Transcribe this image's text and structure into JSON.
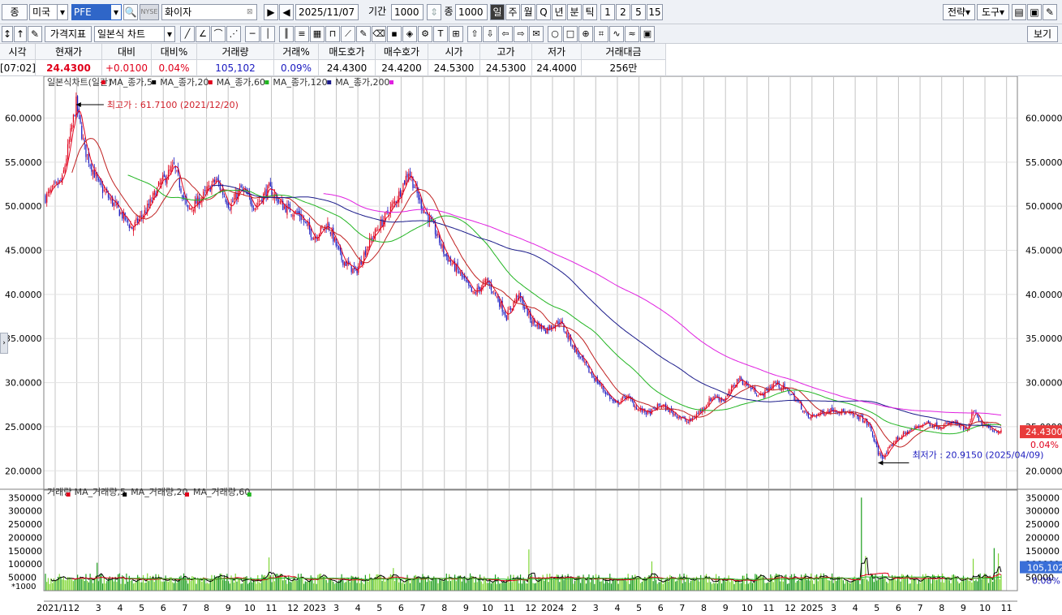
{
  "toolbar1": {
    "item_type": "종",
    "market": "미국",
    "ticker": "PFE",
    "exchange": "NYSE",
    "stock_name": "화이자",
    "date": "2025/11/07",
    "period_label": "기간",
    "period_value": "1000",
    "count_label": "종",
    "count_value": "1000",
    "periods": [
      "일",
      "주",
      "월",
      "Q",
      "년",
      "분",
      "틱"
    ],
    "minutes": [
      "1",
      "2",
      "5",
      "15"
    ],
    "strategy_label": "전략",
    "tools_label": "도구"
  },
  "toolbar2": {
    "indicator_label": "가격지표",
    "chart_type": "일본식 차트",
    "view_label": "보기"
  },
  "quote": {
    "headers": [
      "시각",
      "현재가",
      "대비",
      "대비%",
      "거래량",
      "거래%",
      "매도호가",
      "매수호가",
      "시가",
      "고가",
      "저가",
      "거래대금"
    ],
    "values": [
      "[07:02]",
      "24.4300",
      "+0.0100",
      "0.04%",
      "105,102",
      "0.09%",
      "24.4300",
      "24.4200",
      "24.5300",
      "24.5300",
      "24.4000",
      "256만"
    ]
  },
  "colors": {
    "up": "#e0001b",
    "down": "#1a1ac0",
    "ma5": "#e0001b",
    "ma20": "#000000",
    "ma60": "#c02020",
    "ma120": "#22b522",
    "ma200": "#1a1a8a",
    "ma200b": "#e020e0",
    "vol_up": "#7fd636",
    "vol_down": "#1e9e1e"
  },
  "chart_data": {
    "type": "candlestick",
    "price_legend": [
      {
        "name": "일본식차트(일간)",
        "color": "#e0001b"
      },
      {
        "name": "MA_종가,5",
        "color": "#000000"
      },
      {
        "name": "MA_종가,20",
        "color": "#e0001b"
      },
      {
        "name": "MA_종가,60",
        "color": "#22b522"
      },
      {
        "name": "MA_종가,120",
        "color": "#1a1a8a"
      },
      {
        "name": "MA_종가,200",
        "color": "#e020e0"
      }
    ],
    "volume_legend": [
      {
        "name": "거래량",
        "color": "#e0001b"
      },
      {
        "name": "MA_거래량,5",
        "color": "#000000"
      },
      {
        "name": "MA_거래량,20",
        "color": "#e0001b"
      },
      {
        "name": "MA_거래량,60",
        "color": "#22b522"
      }
    ],
    "price_ylim": [
      18,
      64
    ],
    "price_ticks": [
      "60.0000",
      "55.0000",
      "50.0000",
      "45.0000",
      "40.0000",
      "35.0000",
      "30.0000",
      "25.0000",
      "20.0000"
    ],
    "volume_ylim": [
      0,
      360000
    ],
    "volume_ticks": [
      "350000",
      "300000",
      "250000",
      "200000",
      "150000",
      "100000",
      "50000"
    ],
    "volume_unit": "*1000",
    "last_price": "24.4300",
    "last_change_pct": "0.04%",
    "last_volume": "105,102",
    "last_volume_pct": "0.08%",
    "high_note": "최고가 : 61.7100 (2021/12/20)",
    "low_note": "최저가 : 20.9150 (2025/04/09)",
    "x_labels": [
      "2021/11",
      "2",
      "3",
      "4",
      "5",
      "6",
      "7",
      "8",
      "9",
      "10",
      "11",
      "12",
      "2023",
      "3",
      "4",
      "5",
      "6",
      "7",
      "8",
      "9",
      "10",
      "11",
      "12",
      "2024",
      "2",
      "3",
      "4",
      "5",
      "6",
      "7",
      "8",
      "9",
      "10",
      "11",
      "12",
      "2025",
      "3",
      "4",
      "5",
      "6",
      "7",
      "8",
      "9",
      "10",
      "11"
    ],
    "price_keypoints": [
      [
        0,
        51.0
      ],
      [
        12,
        53.0
      ],
      [
        22,
        61.7
      ],
      [
        28,
        56.5
      ],
      [
        38,
        52.5
      ],
      [
        50,
        50.0
      ],
      [
        62,
        47.5
      ],
      [
        72,
        49.5
      ],
      [
        82,
        52.5
      ],
      [
        92,
        54.5
      ],
      [
        102,
        49.5
      ],
      [
        112,
        51.0
      ],
      [
        122,
        53.0
      ],
      [
        132,
        50.0
      ],
      [
        140,
        52.0
      ],
      [
        150,
        50.0
      ],
      [
        160,
        52.0
      ],
      [
        170,
        50.0
      ],
      [
        182,
        49.0
      ],
      [
        192,
        46.5
      ],
      [
        202,
        48.0
      ],
      [
        212,
        44.0
      ],
      [
        222,
        42.5
      ],
      [
        232,
        46.0
      ],
      [
        242,
        48.5
      ],
      [
        252,
        51.0
      ],
      [
        260,
        54.0
      ],
      [
        268,
        50.5
      ],
      [
        278,
        47.5
      ],
      [
        286,
        44.5
      ],
      [
        296,
        42.5
      ],
      [
        306,
        40.0
      ],
      [
        316,
        41.5
      ],
      [
        322,
        40.0
      ],
      [
        330,
        37.5
      ],
      [
        338,
        40.0
      ],
      [
        348,
        37.0
      ],
      [
        358,
        36.0
      ],
      [
        368,
        37.0
      ],
      [
        378,
        34.0
      ],
      [
        388,
        31.5
      ],
      [
        398,
        29.5
      ],
      [
        408,
        27.5
      ],
      [
        416,
        28.5
      ],
      [
        424,
        27.0
      ],
      [
        432,
        26.5
      ],
      [
        440,
        27.5
      ],
      [
        450,
        26.5
      ],
      [
        460,
        25.5
      ],
      [
        470,
        27.0
      ],
      [
        478,
        28.5
      ],
      [
        486,
        28.0
      ],
      [
        496,
        30.5
      ],
      [
        504,
        29.5
      ],
      [
        512,
        28.5
      ],
      [
        522,
        30.0
      ],
      [
        532,
        29.0
      ],
      [
        540,
        27.5
      ],
      [
        546,
        26.0
      ],
      [
        554,
        26.5
      ],
      [
        564,
        27.0
      ],
      [
        574,
        26.5
      ],
      [
        584,
        26.0
      ],
      [
        590,
        25.0
      ],
      [
        596,
        22.0
      ],
      [
        600,
        21.5
      ],
      [
        608,
        23.5
      ],
      [
        618,
        24.5
      ],
      [
        630,
        25.5
      ],
      [
        640,
        25.0
      ],
      [
        650,
        25.5
      ],
      [
        660,
        24.5
      ],
      [
        664,
        27.0
      ],
      [
        668,
        25.5
      ],
      [
        676,
        24.8
      ],
      [
        684,
        24.43
      ]
    ],
    "price_total_days": 684,
    "volume_base": 45000,
    "volume_spikes": [
      [
        37,
        105000
      ],
      [
        160,
        125000
      ],
      [
        249,
        85000
      ],
      [
        346,
        155000
      ],
      [
        434,
        110000
      ],
      [
        584,
        350000
      ],
      [
        587,
        130000
      ],
      [
        664,
        120000
      ],
      [
        679,
        160000
      ],
      [
        682,
        140000
      ]
    ]
  }
}
